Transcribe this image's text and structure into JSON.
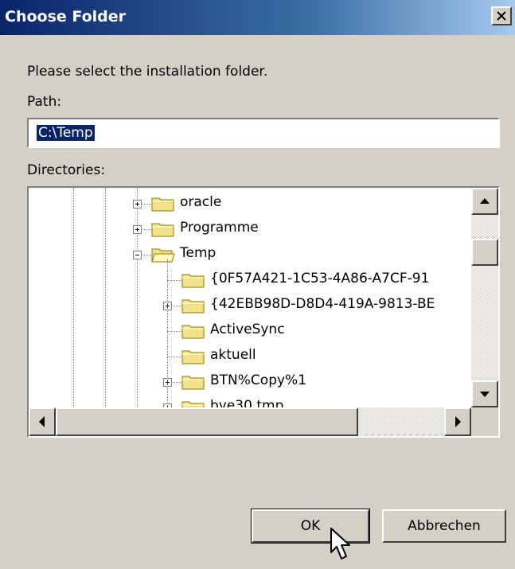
{
  "window": {
    "title": "Choose Folder",
    "close_glyph": "✕"
  },
  "prompt": "Please select the installation folder.",
  "path": {
    "label": "Path:",
    "value": "C:\\Temp"
  },
  "directories": {
    "label": "Directories:",
    "items": [
      {
        "label": "oracle",
        "state": "collapsed"
      },
      {
        "label": "Programme",
        "state": "collapsed"
      },
      {
        "label": "Temp",
        "state": "expanded"
      },
      {
        "label": "{0F57A421-1C53-4A86-A7CF-91",
        "state": "none"
      },
      {
        "label": "{42EBB98D-D8D4-419A-9813-BE",
        "state": "collapsed"
      },
      {
        "label": "ActiveSync",
        "state": "none"
      },
      {
        "label": "aktuell",
        "state": "none"
      },
      {
        "label": "BTN%Copy%1",
        "state": "collapsed"
      },
      {
        "label": "bye30.tmp",
        "state": "collapsed"
      }
    ]
  },
  "buttons": {
    "ok": "OK",
    "cancel": "Abbrechen"
  },
  "icons": {
    "folder": "folder-icon",
    "open_folder": "folder-open-icon",
    "cursor": "mouse-pointer-icon"
  },
  "colors": {
    "folder_fill": "#f5e08a",
    "selection": "#0a246a",
    "title_start": "#0a246a"
  }
}
